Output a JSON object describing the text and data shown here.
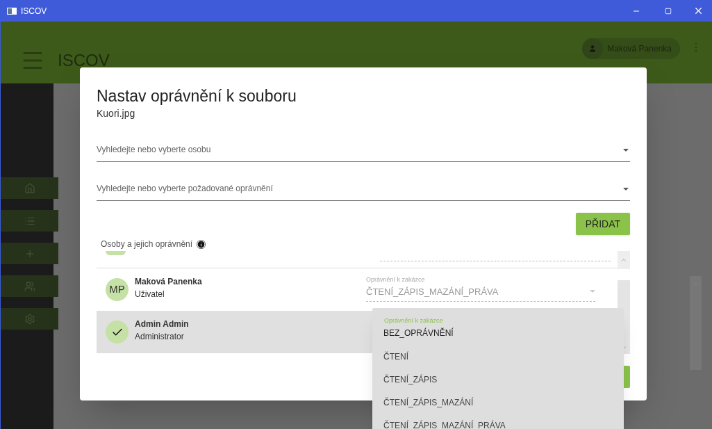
{
  "window": {
    "title": "ISCOV"
  },
  "app_bar": {
    "title": "ISCOV",
    "user": "Maková Panenka"
  },
  "dialog": {
    "title": "Nastav oprávnění k souboru",
    "subtitle": "Kuori.jpg",
    "person_field": {
      "placeholder": "Vyhledejte nebo vyberte osobu"
    },
    "permission_field": {
      "placeholder": "Vyhledejte nebo vyberte požadované oprávnění"
    },
    "add_button": "PŘIDAT",
    "section_label": "Osoby a jejich oprávnění",
    "people": [
      {
        "initials": "MP",
        "name": "Maková Panenka",
        "role": "Uživatel",
        "selected": false,
        "field_label": "Oprávnění k zakázce",
        "permission": "ČTENÍ_ZÁPIS_MAZÁNÍ_PRÁVA"
      },
      {
        "name": "Admin Admin",
        "role": "Administrator",
        "selected": true
      }
    ]
  },
  "dropdown": {
    "label": "Oprávnění k zakázce",
    "options": [
      {
        "label": "BEZ_OPRÁVNĚNÍ",
        "selected": true
      },
      {
        "label": "ČTENÍ",
        "selected": false
      },
      {
        "label": "ČTENÍ_ZÁPIS",
        "selected": false
      },
      {
        "label": "ČTENÍ_ZÁPIS_MAZÁNÍ",
        "selected": false
      },
      {
        "label": "ČTENÍ_ZÁPIS_MAZÁNÍ_PRÁVA",
        "selected": false
      }
    ]
  }
}
